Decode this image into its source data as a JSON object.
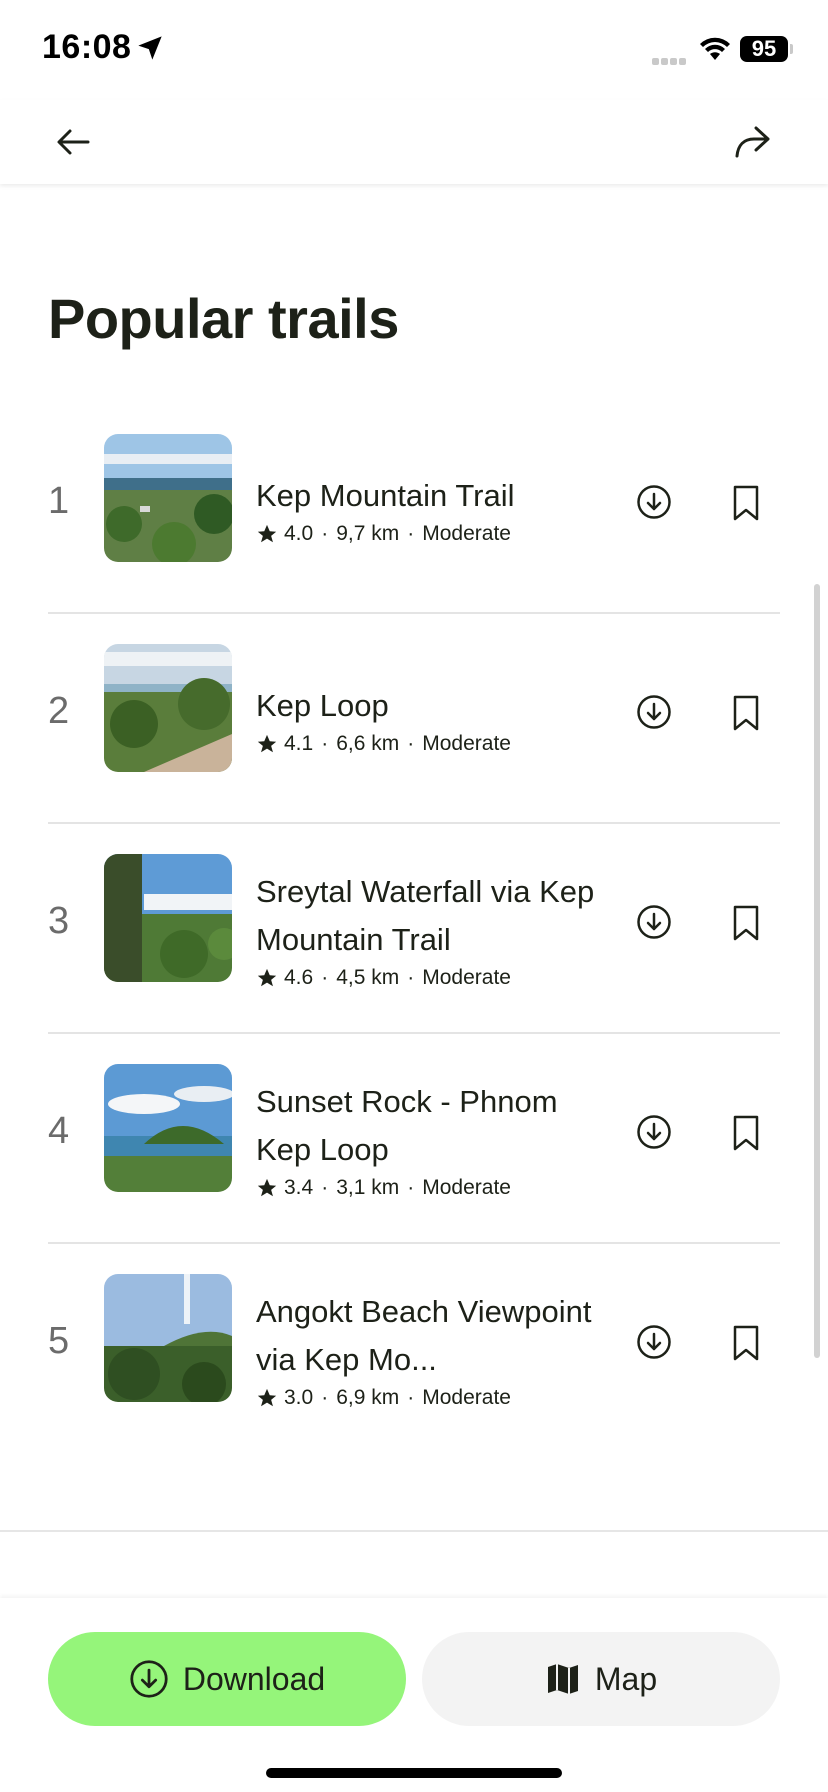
{
  "status_bar": {
    "time": "16:08",
    "battery": "95"
  },
  "header": {
    "back_icon": "arrow-left-icon",
    "share_icon": "share-arrow-icon"
  },
  "page": {
    "title": "Popular trails"
  },
  "trails": [
    {
      "rank": "1",
      "name": "Kep Mountain Trail",
      "rating": "4.0",
      "distance": "9,7 km",
      "difficulty": "Moderate"
    },
    {
      "rank": "2",
      "name": "Kep Loop",
      "rating": "4.1",
      "distance": "6,6 km",
      "difficulty": "Moderate"
    },
    {
      "rank": "3",
      "name": "Sreytal Waterfall via Kep Mountain Trail",
      "rating": "4.6",
      "distance": "4,5 km",
      "difficulty": "Moderate"
    },
    {
      "rank": "4",
      "name": "Sunset Rock - Phnom Kep Loop",
      "rating": "3.4",
      "distance": "3,1 km",
      "difficulty": "Moderate"
    },
    {
      "rank": "5",
      "name": "Angokt Beach Viewpoint via Kep Mo...",
      "rating": "3.0",
      "distance": "6,9 km",
      "difficulty": "Moderate"
    }
  ],
  "bottom": {
    "download_label": "Download",
    "map_label": "Map"
  },
  "colors": {
    "accent_green": "#95f57a",
    "text_dark": "#1d2118",
    "secondary_bg": "#f3f3f3"
  }
}
